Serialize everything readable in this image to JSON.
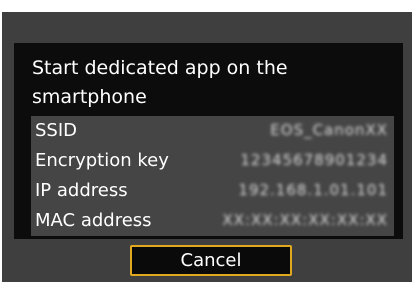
{
  "dialog": {
    "message": "Start dedicated app on the smartphone",
    "rows": [
      {
        "label": "SSID",
        "value": "EOS_CanonXX"
      },
      {
        "label": "Encryption key",
        "value": "12345678901234"
      },
      {
        "label": "IP address",
        "value": "192.168.1.01.101"
      },
      {
        "label": "MAC address",
        "value": "XX:XX:XX:XX:XX:XX"
      }
    ],
    "cancel_label": "Cancel"
  },
  "colors": {
    "frame": "#3f3f3f",
    "screen": "#0c0c0c",
    "table": "#454545",
    "focus_border": "#e0a81f",
    "text": "#ffffff"
  }
}
